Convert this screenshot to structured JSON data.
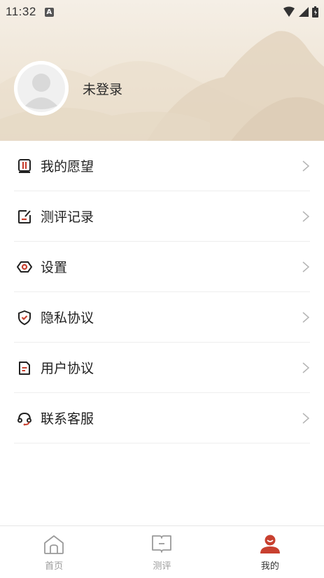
{
  "status_bar": {
    "time": "11:32",
    "notification_glyph": "A",
    "icons": [
      "wifi-icon",
      "signal-icon",
      "battery-icon"
    ]
  },
  "profile": {
    "avatar_icon": "default-avatar-icon",
    "login_label": "未登录"
  },
  "menu": {
    "items": [
      {
        "label": "我的愿望",
        "icon": "wish-book-icon"
      },
      {
        "label": "测评记录",
        "icon": "record-edit-icon"
      },
      {
        "label": "设置",
        "icon": "settings-hexagon-icon"
      },
      {
        "label": "隐私协议",
        "icon": "privacy-shield-icon"
      },
      {
        "label": "用户协议",
        "icon": "document-icon"
      },
      {
        "label": "联系客服",
        "icon": "headset-icon"
      }
    ]
  },
  "tabbar": {
    "tabs": [
      {
        "label": "首页",
        "icon": "home-icon",
        "active": false
      },
      {
        "label": "测评",
        "icon": "book-icon",
        "active": false
      },
      {
        "label": "我的",
        "icon": "person-icon",
        "active": true
      }
    ]
  },
  "colors": {
    "accent": "#c8402f",
    "header_bg": "#f1e8da",
    "text": "#222222",
    "muted": "#9a9a9a"
  }
}
